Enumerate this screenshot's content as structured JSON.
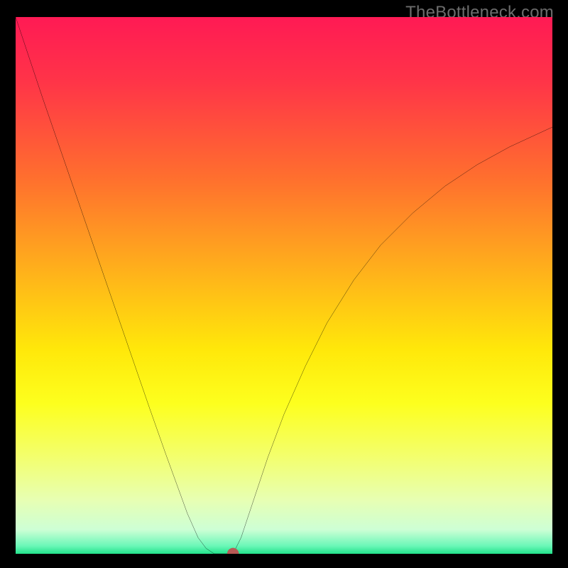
{
  "watermark": "TheBottleneck.com",
  "chart_data": {
    "type": "line",
    "title": "",
    "xlabel": "",
    "ylabel": "",
    "xlim": [
      0,
      100
    ],
    "ylim": [
      0,
      100
    ],
    "gradient_stops": [
      {
        "offset": 0.0,
        "color": "#ff1a54"
      },
      {
        "offset": 0.12,
        "color": "#ff3448"
      },
      {
        "offset": 0.3,
        "color": "#ff6f2e"
      },
      {
        "offset": 0.5,
        "color": "#ffbb18"
      },
      {
        "offset": 0.62,
        "color": "#ffe80a"
      },
      {
        "offset": 0.72,
        "color": "#fdff1e"
      },
      {
        "offset": 0.82,
        "color": "#f3ff6e"
      },
      {
        "offset": 0.9,
        "color": "#e7ffb3"
      },
      {
        "offset": 0.955,
        "color": "#cdffd5"
      },
      {
        "offset": 0.985,
        "color": "#6cf7b8"
      },
      {
        "offset": 1.0,
        "color": "#22e38b"
      }
    ],
    "series": [
      {
        "name": "left-branch",
        "x": [
          0,
          5,
          10,
          15,
          20,
          25,
          28,
          30,
          32,
          34,
          35.5,
          37
        ],
        "y": [
          100,
          85,
          70.5,
          56,
          41.5,
          27,
          18.5,
          13,
          7.5,
          3,
          1,
          0
        ]
      },
      {
        "name": "bottom-plateau",
        "x": [
          37,
          40.5
        ],
        "y": [
          0,
          0
        ]
      },
      {
        "name": "right-branch",
        "x": [
          40.5,
          42,
          44,
          47,
          50,
          54,
          58,
          63,
          68,
          74,
          80,
          86,
          92,
          100
        ],
        "y": [
          0,
          3,
          9,
          18,
          26,
          35,
          43,
          51,
          57.5,
          63.5,
          68.5,
          72.5,
          75.8,
          79.5
        ]
      }
    ],
    "marker": {
      "x": 40.5,
      "y": 0,
      "color": "#b85a55",
      "radius_pct": 1.1
    }
  }
}
